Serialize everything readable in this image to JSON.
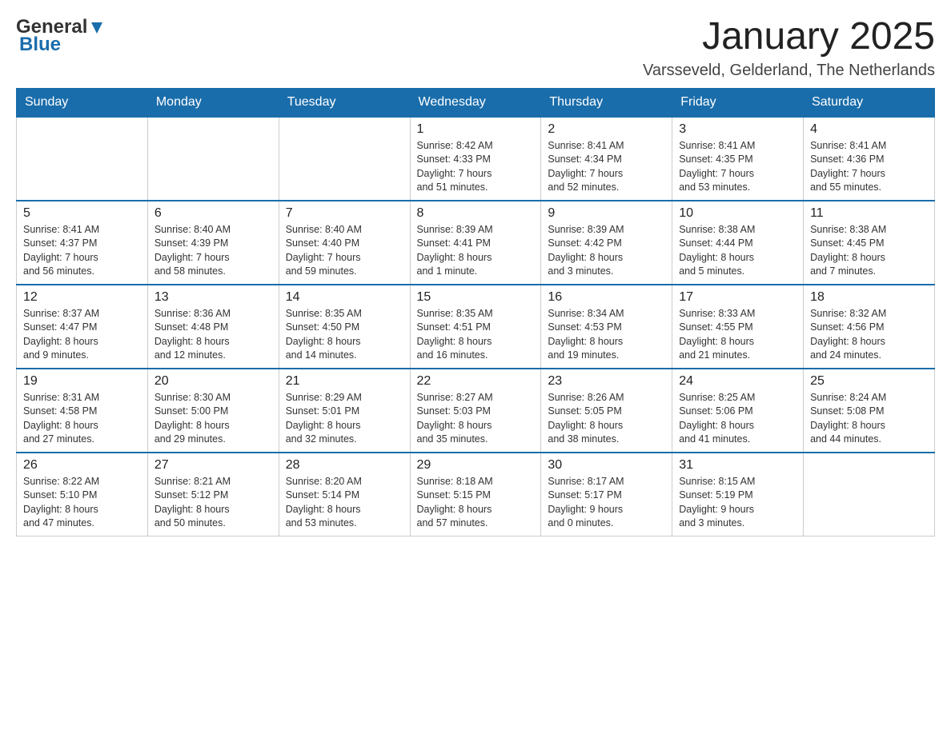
{
  "header": {
    "logo": {
      "general": "General",
      "blue": "Blue"
    },
    "month_title": "January 2025",
    "location": "Varsseveld, Gelderland, The Netherlands"
  },
  "days_of_week": [
    "Sunday",
    "Monday",
    "Tuesday",
    "Wednesday",
    "Thursday",
    "Friday",
    "Saturday"
  ],
  "weeks": [
    [
      {
        "day": "",
        "info": ""
      },
      {
        "day": "",
        "info": ""
      },
      {
        "day": "",
        "info": ""
      },
      {
        "day": "1",
        "info": "Sunrise: 8:42 AM\nSunset: 4:33 PM\nDaylight: 7 hours\nand 51 minutes."
      },
      {
        "day": "2",
        "info": "Sunrise: 8:41 AM\nSunset: 4:34 PM\nDaylight: 7 hours\nand 52 minutes."
      },
      {
        "day": "3",
        "info": "Sunrise: 8:41 AM\nSunset: 4:35 PM\nDaylight: 7 hours\nand 53 minutes."
      },
      {
        "day": "4",
        "info": "Sunrise: 8:41 AM\nSunset: 4:36 PM\nDaylight: 7 hours\nand 55 minutes."
      }
    ],
    [
      {
        "day": "5",
        "info": "Sunrise: 8:41 AM\nSunset: 4:37 PM\nDaylight: 7 hours\nand 56 minutes."
      },
      {
        "day": "6",
        "info": "Sunrise: 8:40 AM\nSunset: 4:39 PM\nDaylight: 7 hours\nand 58 minutes."
      },
      {
        "day": "7",
        "info": "Sunrise: 8:40 AM\nSunset: 4:40 PM\nDaylight: 7 hours\nand 59 minutes."
      },
      {
        "day": "8",
        "info": "Sunrise: 8:39 AM\nSunset: 4:41 PM\nDaylight: 8 hours\nand 1 minute."
      },
      {
        "day": "9",
        "info": "Sunrise: 8:39 AM\nSunset: 4:42 PM\nDaylight: 8 hours\nand 3 minutes."
      },
      {
        "day": "10",
        "info": "Sunrise: 8:38 AM\nSunset: 4:44 PM\nDaylight: 8 hours\nand 5 minutes."
      },
      {
        "day": "11",
        "info": "Sunrise: 8:38 AM\nSunset: 4:45 PM\nDaylight: 8 hours\nand 7 minutes."
      }
    ],
    [
      {
        "day": "12",
        "info": "Sunrise: 8:37 AM\nSunset: 4:47 PM\nDaylight: 8 hours\nand 9 minutes."
      },
      {
        "day": "13",
        "info": "Sunrise: 8:36 AM\nSunset: 4:48 PM\nDaylight: 8 hours\nand 12 minutes."
      },
      {
        "day": "14",
        "info": "Sunrise: 8:35 AM\nSunset: 4:50 PM\nDaylight: 8 hours\nand 14 minutes."
      },
      {
        "day": "15",
        "info": "Sunrise: 8:35 AM\nSunset: 4:51 PM\nDaylight: 8 hours\nand 16 minutes."
      },
      {
        "day": "16",
        "info": "Sunrise: 8:34 AM\nSunset: 4:53 PM\nDaylight: 8 hours\nand 19 minutes."
      },
      {
        "day": "17",
        "info": "Sunrise: 8:33 AM\nSunset: 4:55 PM\nDaylight: 8 hours\nand 21 minutes."
      },
      {
        "day": "18",
        "info": "Sunrise: 8:32 AM\nSunset: 4:56 PM\nDaylight: 8 hours\nand 24 minutes."
      }
    ],
    [
      {
        "day": "19",
        "info": "Sunrise: 8:31 AM\nSunset: 4:58 PM\nDaylight: 8 hours\nand 27 minutes."
      },
      {
        "day": "20",
        "info": "Sunrise: 8:30 AM\nSunset: 5:00 PM\nDaylight: 8 hours\nand 29 minutes."
      },
      {
        "day": "21",
        "info": "Sunrise: 8:29 AM\nSunset: 5:01 PM\nDaylight: 8 hours\nand 32 minutes."
      },
      {
        "day": "22",
        "info": "Sunrise: 8:27 AM\nSunset: 5:03 PM\nDaylight: 8 hours\nand 35 minutes."
      },
      {
        "day": "23",
        "info": "Sunrise: 8:26 AM\nSunset: 5:05 PM\nDaylight: 8 hours\nand 38 minutes."
      },
      {
        "day": "24",
        "info": "Sunrise: 8:25 AM\nSunset: 5:06 PM\nDaylight: 8 hours\nand 41 minutes."
      },
      {
        "day": "25",
        "info": "Sunrise: 8:24 AM\nSunset: 5:08 PM\nDaylight: 8 hours\nand 44 minutes."
      }
    ],
    [
      {
        "day": "26",
        "info": "Sunrise: 8:22 AM\nSunset: 5:10 PM\nDaylight: 8 hours\nand 47 minutes."
      },
      {
        "day": "27",
        "info": "Sunrise: 8:21 AM\nSunset: 5:12 PM\nDaylight: 8 hours\nand 50 minutes."
      },
      {
        "day": "28",
        "info": "Sunrise: 8:20 AM\nSunset: 5:14 PM\nDaylight: 8 hours\nand 53 minutes."
      },
      {
        "day": "29",
        "info": "Sunrise: 8:18 AM\nSunset: 5:15 PM\nDaylight: 8 hours\nand 57 minutes."
      },
      {
        "day": "30",
        "info": "Sunrise: 8:17 AM\nSunset: 5:17 PM\nDaylight: 9 hours\nand 0 minutes."
      },
      {
        "day": "31",
        "info": "Sunrise: 8:15 AM\nSunset: 5:19 PM\nDaylight: 9 hours\nand 3 minutes."
      },
      {
        "day": "",
        "info": ""
      }
    ]
  ]
}
